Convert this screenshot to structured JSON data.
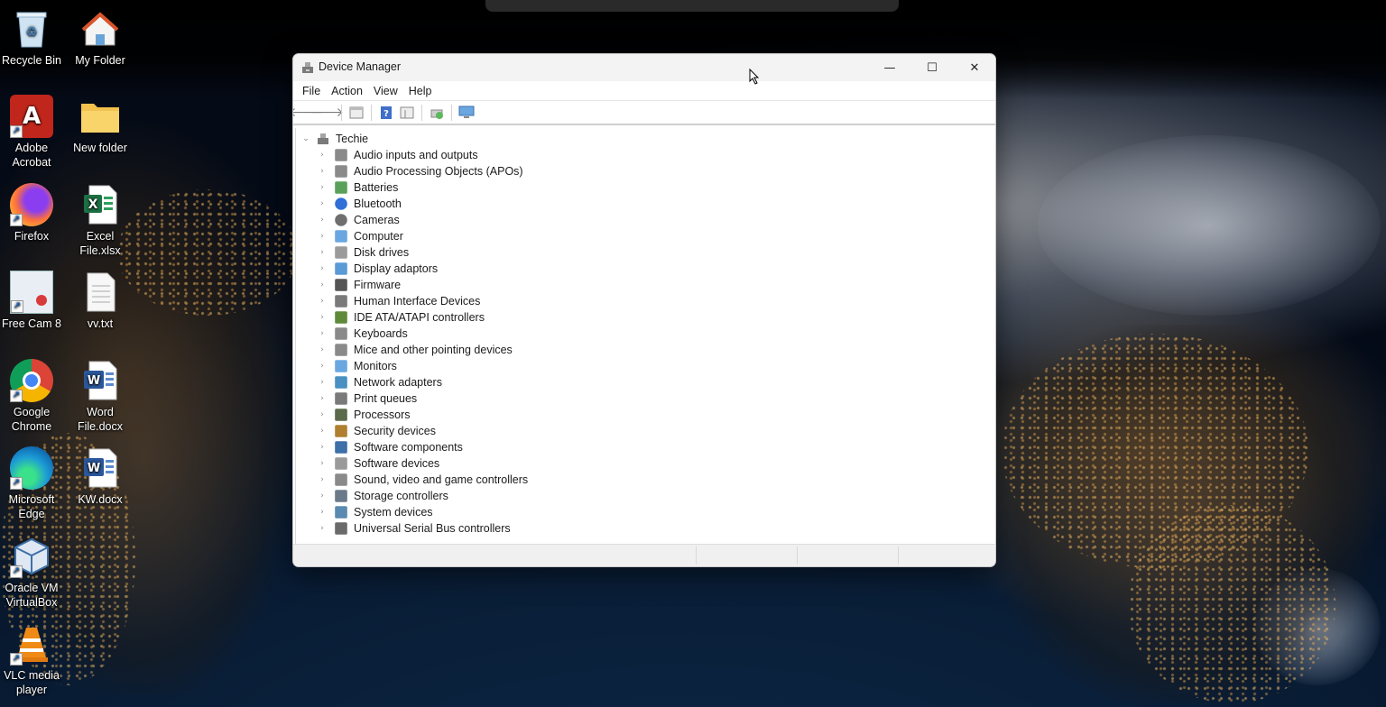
{
  "desktop": {
    "icons": [
      {
        "label": "Recycle Bin",
        "icon": "recycle-bin-icon"
      },
      {
        "label": "My Folder",
        "icon": "house-folder-icon"
      },
      {
        "label": "Adobe Acrobat",
        "icon": "acrobat-icon"
      },
      {
        "label": "New folder",
        "icon": "folder-icon"
      },
      {
        "label": "Firefox",
        "icon": "firefox-icon"
      },
      {
        "label": "Excel File.xlsx",
        "icon": "excel-icon"
      },
      {
        "label": "Free Cam 8",
        "icon": "freecam-icon"
      },
      {
        "label": "vv.txt",
        "icon": "text-file-icon"
      },
      {
        "label": "Google Chrome",
        "icon": "chrome-icon"
      },
      {
        "label": "Word File.docx",
        "icon": "word-icon"
      },
      {
        "label": "Microsoft Edge",
        "icon": "edge-icon"
      },
      {
        "label": "KW.docx",
        "icon": "word-icon"
      },
      {
        "label": "Oracle VM VirtualBox",
        "icon": "virtualbox-icon"
      },
      {
        "label": "VLC media player",
        "icon": "vlc-icon"
      }
    ]
  },
  "window": {
    "title": "Device Manager",
    "controls": {
      "minimize": "—",
      "maximize": "☐",
      "close": "✕"
    },
    "menu": [
      "File",
      "Action",
      "View",
      "Help"
    ],
    "toolbar": [
      "back-icon",
      "forward-icon",
      "properties-icon",
      "help-icon",
      "view-icon",
      "update-driver-icon",
      "scan-hardware-icon"
    ],
    "tree": {
      "root": "Techie",
      "categories": [
        "Audio inputs and outputs",
        "Audio Processing Objects (APOs)",
        "Batteries",
        "Bluetooth",
        "Cameras",
        "Computer",
        "Disk drives",
        "Display adaptors",
        "Firmware",
        "Human Interface Devices",
        "IDE ATA/ATAPI controllers",
        "Keyboards",
        "Mice and other pointing devices",
        "Monitors",
        "Network adapters",
        "Print queues",
        "Processors",
        "Security devices",
        "Software components",
        "Software devices",
        "Sound, video and game controllers",
        "Storage controllers",
        "System devices",
        "Universal Serial Bus controllers"
      ]
    }
  }
}
